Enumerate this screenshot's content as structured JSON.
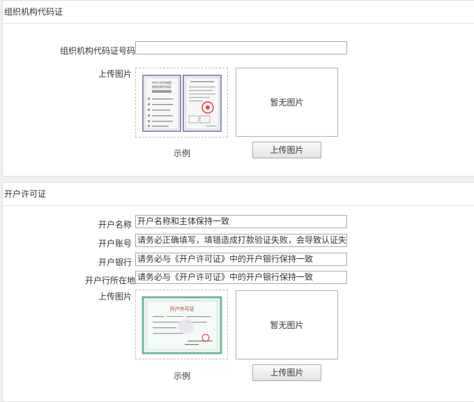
{
  "org_section": {
    "title": "组织机构代码证",
    "code_label": "组织机构代码证号码",
    "code_value": "",
    "upload_label": "上传图片",
    "sample_caption": "示例",
    "preview_text": "暂无图片",
    "upload_button": "上传图片",
    "sample_doc": {
      "heading1": "中华人民共和国",
      "heading2": "组织机构代码证"
    }
  },
  "license_section": {
    "title": "开户许可证",
    "fields": [
      {
        "label": "开户名称",
        "value": "开户名称和主体保持一致"
      },
      {
        "label": "开户账号",
        "value": "请务必正确填写，填错造成打款验证失败，会导致认证失败"
      },
      {
        "label": "开户银行",
        "value": "请务必与《开户许可证》中的开户银行保持一致"
      },
      {
        "label": "开户行所在地",
        "value": "请务必与《开户许可证》中的开户银行保持一致"
      }
    ],
    "upload_label": "上传图片",
    "sample_caption": "示例",
    "preview_text": "暂无图片",
    "upload_button": "上传图片",
    "sample_doc": {
      "heading": "开户许可证"
    }
  }
}
